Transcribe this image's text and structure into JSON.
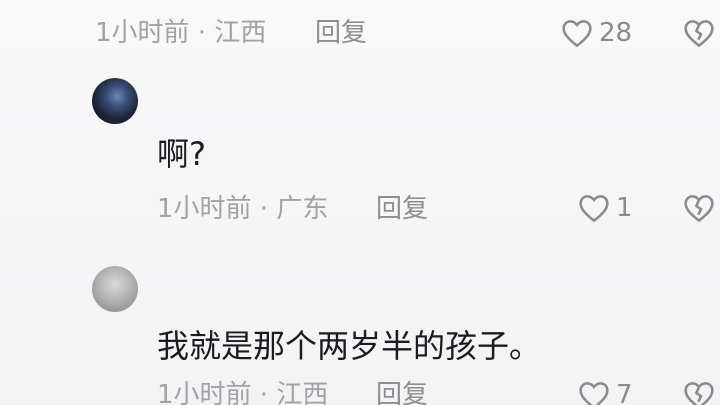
{
  "comments": [
    {
      "meta": "1小时前 · 江西",
      "reply_label": "回复",
      "like_count": "28"
    },
    {
      "text": "啊?",
      "meta": "1小时前 · 广东",
      "reply_label": "回复",
      "like_count": "1"
    },
    {
      "text": "我就是那个两岁半的孩子。",
      "meta": "1小时前 · 江西",
      "reply_label": "回复",
      "like_count": "7"
    }
  ],
  "icons": {
    "like": "heart-outline-icon",
    "dislike": "broken-heart-icon"
  }
}
